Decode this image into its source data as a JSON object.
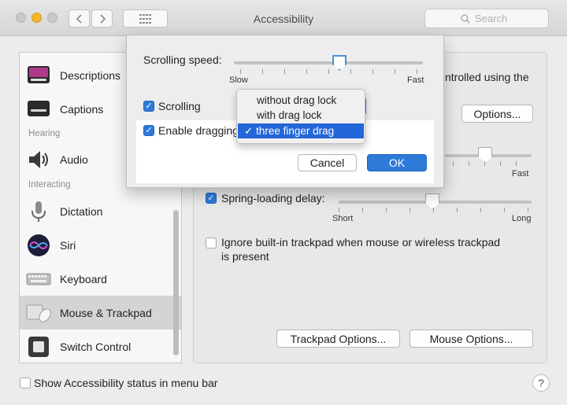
{
  "window": {
    "title": "Accessibility"
  },
  "search": {
    "placeholder": "Search"
  },
  "sidebar": {
    "items": [
      {
        "label": "Descriptions"
      },
      {
        "label": "Captions"
      },
      {
        "label": "Audio"
      },
      {
        "label": "Dictation"
      },
      {
        "label": "Siri"
      },
      {
        "label": "Keyboard"
      },
      {
        "label": "Mouse & Trackpad"
      },
      {
        "label": "Switch Control"
      }
    ],
    "sections": {
      "hearing": "Hearing",
      "interacting": "Interacting"
    }
  },
  "main": {
    "controlled_text": "ntrolled using the",
    "options_button": "Options...",
    "double_click_fast": "Fast",
    "spring_loading": {
      "label": "Spring-loading delay:",
      "checked": true,
      "min": "Short",
      "max": "Long"
    },
    "ignore_trackpad": {
      "line1": "Ignore built-in trackpad when mouse or wireless trackpad",
      "line2": "is present",
      "checked": false
    },
    "trackpad_options_button": "Trackpad Options...",
    "mouse_options_button": "Mouse Options..."
  },
  "sheet": {
    "scrolling_speed": {
      "label": "Scrolling speed:",
      "min": "Slow",
      "max": "Fast",
      "value_fraction": 0.55
    },
    "scrolling": {
      "label": "Scrolling",
      "checked": true
    },
    "enable_dragging": {
      "label": "Enable dragging",
      "checked": true
    },
    "drag_options": [
      {
        "label": "without drag lock",
        "selected": false
      },
      {
        "label": "with drag lock",
        "selected": false
      },
      {
        "label": "three finger drag",
        "selected": true
      }
    ],
    "cancel_button": "Cancel",
    "ok_button": "OK"
  },
  "footer": {
    "status_menu_label": "Show Accessibility status in menu bar",
    "checked": false
  },
  "colors": {
    "accent": "#2e7ad8",
    "selection": "#2366d9",
    "traffic_yellow": "#f5b52b"
  },
  "icons": [
    "back-arrow-icon",
    "forward-arrow-icon",
    "grid-icon",
    "search-icon",
    "checkmark-icon",
    "help-icon"
  ]
}
